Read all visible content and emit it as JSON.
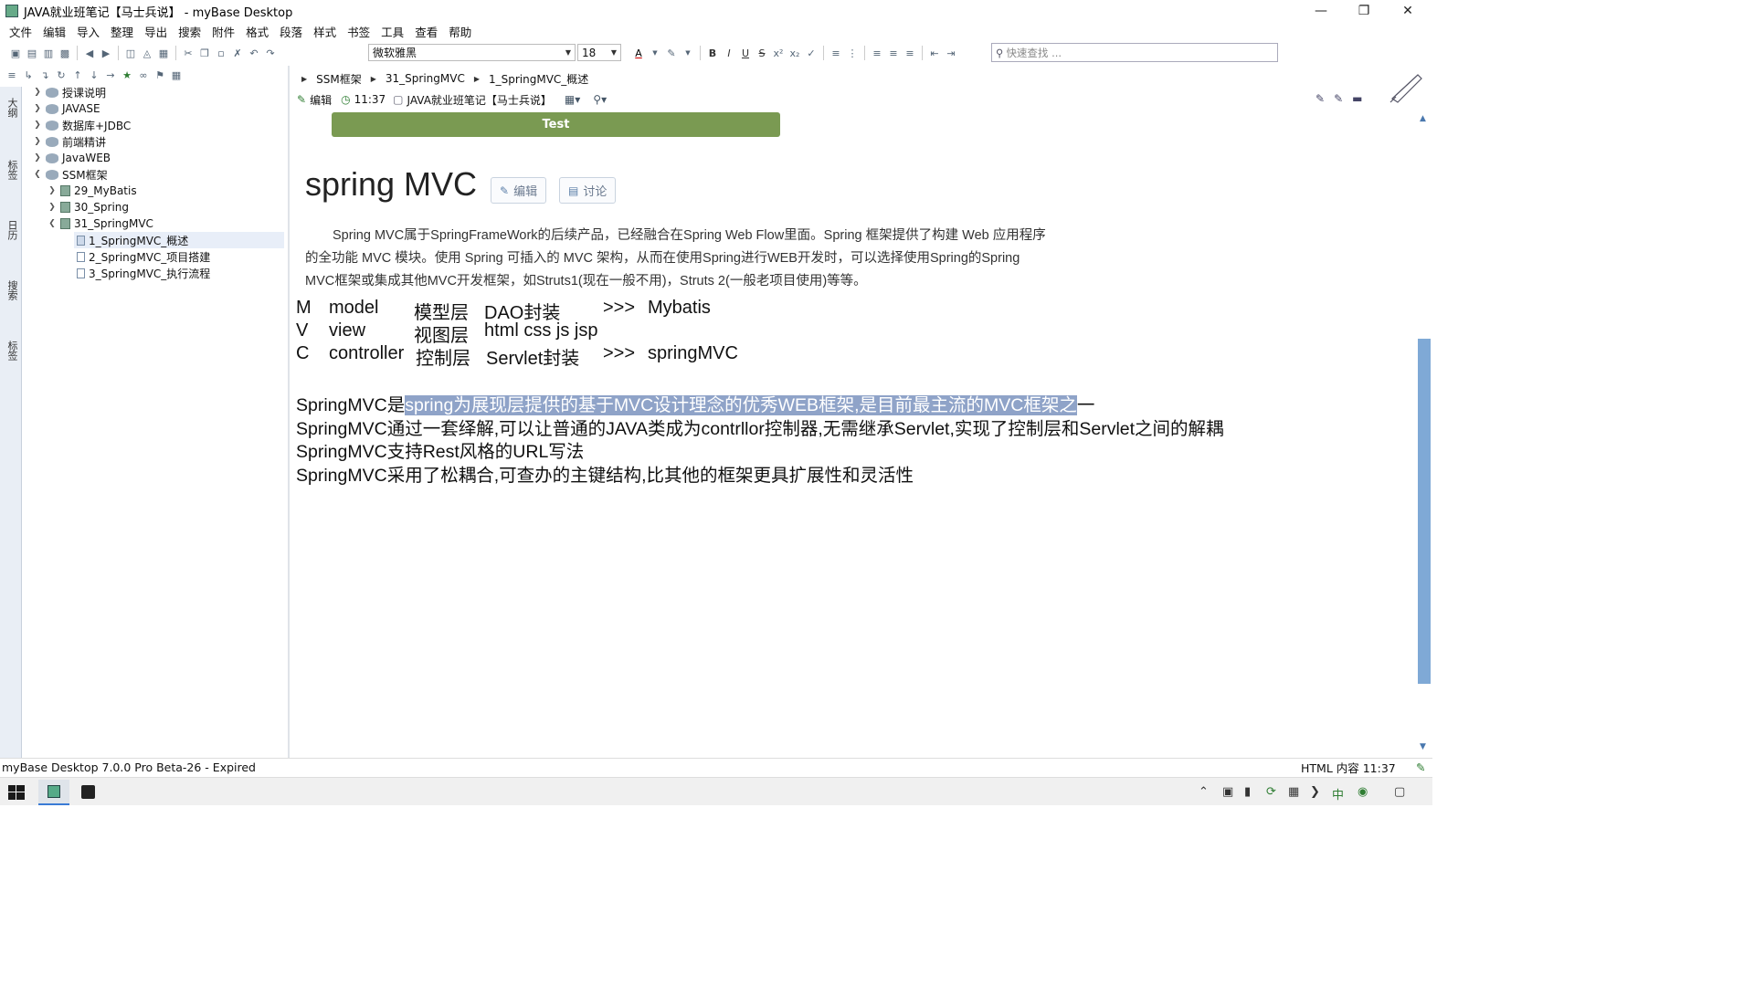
{
  "window": {
    "title": "JAVA就业班笔记【马士兵说】 - myBase Desktop"
  },
  "menu": [
    "文件",
    "编辑",
    "导入",
    "整理",
    "导出",
    "搜索",
    "附件",
    "格式",
    "段落",
    "样式",
    "书签",
    "工具",
    "查看",
    "帮助"
  ],
  "toolbar": {
    "font_name": "微软雅黑",
    "font_size": "18",
    "font_color_label": "A",
    "bold": "B",
    "italic": "I",
    "underline": "U",
    "strike": "S",
    "quick_search_placeholder": "快速查找 ..."
  },
  "vtabs": [
    "大纲",
    "标签",
    "日历",
    "搜索",
    "标签"
  ],
  "tree": [
    {
      "label": "授课说明",
      "level": 0,
      "expanded": false,
      "icon": "database-icon"
    },
    {
      "label": "JAVASE",
      "level": 0,
      "expanded": false,
      "icon": "database-icon"
    },
    {
      "label": "数据库+JDBC",
      "level": 0,
      "expanded": false,
      "icon": "database-icon"
    },
    {
      "label": "前端精讲",
      "level": 0,
      "expanded": false,
      "icon": "database-icon"
    },
    {
      "label": "JavaWEB",
      "level": 0,
      "expanded": false,
      "icon": "database-icon"
    },
    {
      "label": "SSM框架",
      "level": 0,
      "expanded": true,
      "icon": "database-icon"
    },
    {
      "label": "29_MyBatis",
      "level": 1,
      "expanded": false,
      "icon": "book-icon"
    },
    {
      "label": "30_Spring",
      "level": 1,
      "expanded": false,
      "icon": "book-icon"
    },
    {
      "label": "31_SpringMVC",
      "level": 1,
      "expanded": true,
      "icon": "book-icon"
    },
    {
      "label": "1_SpringMVC_概述",
      "level": 2,
      "selected": true,
      "icon": "page-icon"
    },
    {
      "label": "2_SpringMVC_项目搭建",
      "level": 2,
      "icon": "page-icon"
    },
    {
      "label": "3_SpringMVC_执行流程",
      "level": 2,
      "icon": "page-icon"
    }
  ],
  "breadcrumb": [
    "SSM框架",
    "31_SpringMVC",
    "1_SpringMVC_概述"
  ],
  "infobar": {
    "edit": "编辑",
    "time": "11:37",
    "notebook": "JAVA就业班笔记【马士兵说】"
  },
  "content": {
    "test_bar": "Test",
    "title": "spring MVC",
    "edit_button": "编辑",
    "discuss_button": "讨论",
    "intro_lines": [
      "Spring MVC属于SpringFrameWork的后续产品，已经融合在Spring Web Flow里面。Spring 框架提供了构建 Web 应用程序",
      "的全功能 MVC 模块。使用 Spring 可插入的 MVC 架构，从而在使用Spring进行WEB开发时，可以选择使用Spring的Spring",
      "MVC框架或集成其他MVC开发框架，如Struts1(现在一般不用)，Struts 2(一般老项目使用)等等。"
    ],
    "mvc_rows": [
      {
        "letter": "M",
        "name": "model",
        "layer": "模型层",
        "desc": "DAO封装",
        "arrow": ">>>",
        "tech": "Mybatis"
      },
      {
        "letter": "V",
        "name": "view",
        "layer": "视图层",
        "desc": "html css js  jsp",
        "arrow": "",
        "tech": ""
      },
      {
        "letter": "C",
        "name": "controller",
        "layer": "控制层",
        "desc": "Servlet封装",
        "arrow": ">>>",
        "tech": "springMVC"
      }
    ],
    "line1_prefix": "SpringMVC是",
    "line1_highlight": "spring为展现层提供的基于MVC设计理念的优秀WEB框架,是目前最主流的MVC框架之",
    "line1_suffix": "一",
    "line2": "SpringMVC通过一套绎解,可以让普通的JAVA类成为contrllor控制器,无需继承Servlet,实现了控制层和Servlet之间的解耦",
    "line3": "SpringMVC支持Rest风格的URL写法",
    "line4": "SpringMVC采用了松耦合,可查办的主键结构,比其他的框架更具扩展性和灵活性"
  },
  "status": {
    "left": "myBase Desktop 7.0.0 Pro Beta-26 - Expired",
    "right": "HTML 内容  11:37"
  },
  "colors": {
    "test_bar": "#7a9a52",
    "highlight": "#8fa3c8",
    "scroll_thumb": "#7fa9d6"
  }
}
